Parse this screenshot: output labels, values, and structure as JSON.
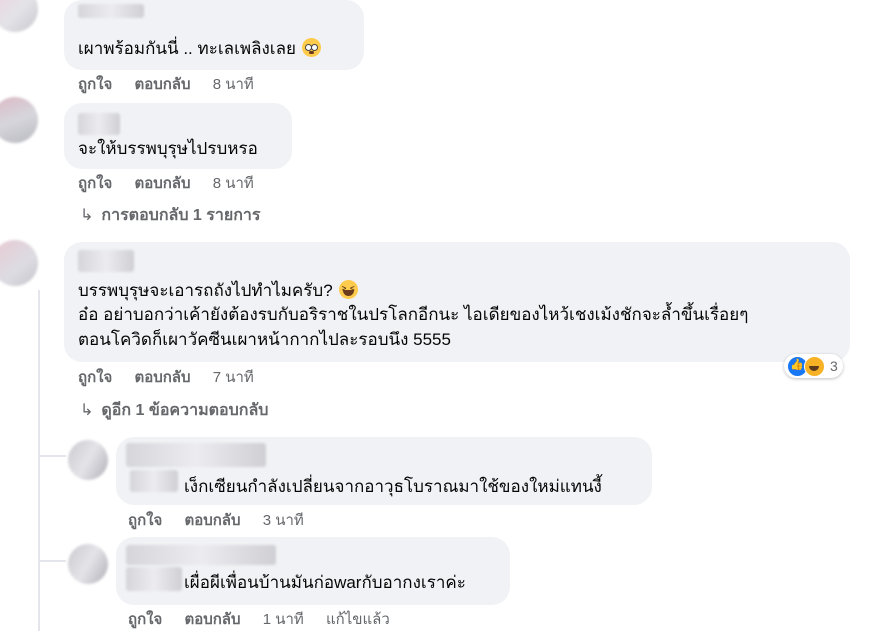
{
  "comments": [
    {
      "text": "เผาพร้อมกันนี่ .. ทะเลเพลิงเลย",
      "emoji": "flushed-face",
      "like_label": "ถูกใจ",
      "reply_label": "ตอบกลับ",
      "time": "8 นาที"
    },
    {
      "text": "จะให้บรรพบุรุษไปรบหรอ",
      "like_label": "ถูกใจ",
      "reply_label": "ตอบกลับ",
      "time": "8 นาที",
      "view_replies": "การตอบกลับ 1 รายการ"
    },
    {
      "line1": "บรรพบุรุษจะเอารถถังไปทำไมครับ?",
      "emoji": "laughing-face",
      "line2": "อ๋อ อย่าบอกว่าเค้ายังต้องรบกับอริราชในปรโลกอีกนะ ไอเดียของไหว้เชงเม้งชักจะล้ำขึ้นเรื่อยๆ",
      "line3": "ตอนโควิดก็เผาวัคซีนเผาหน้ากากไปละรอบนึง 5555",
      "like_label": "ถูกใจ",
      "reply_label": "ตอบกลับ",
      "time": "7 นาที",
      "reaction_count": "3",
      "reaction_icons": [
        "like-icon",
        "haha-icon"
      ],
      "view_more": "ดูอีก 1 ข้อความตอบกลับ"
    }
  ],
  "replies": [
    {
      "text": "เง็กเซียนกำลังเปลี่ยนจากอาวุธโบราณมาใช้ของใหม่แทนงี้",
      "like_label": "ถูกใจ",
      "reply_label": "ตอบกลับ",
      "time": "3 นาที"
    },
    {
      "text": "เผื่อผีเพื่อนบ้านมันก่อwarกับอากงเราค่ะ",
      "like_label": "ถูกใจ",
      "reply_label": "ตอบกลับ",
      "time": "1 นาที",
      "edited_label": "แก้ไขแล้ว"
    }
  ],
  "colors": {
    "bubble": "#f0f2f5",
    "meta_text": "#65676b",
    "like_blue": "#1877f2",
    "haha_yellow": "#f7b125"
  }
}
